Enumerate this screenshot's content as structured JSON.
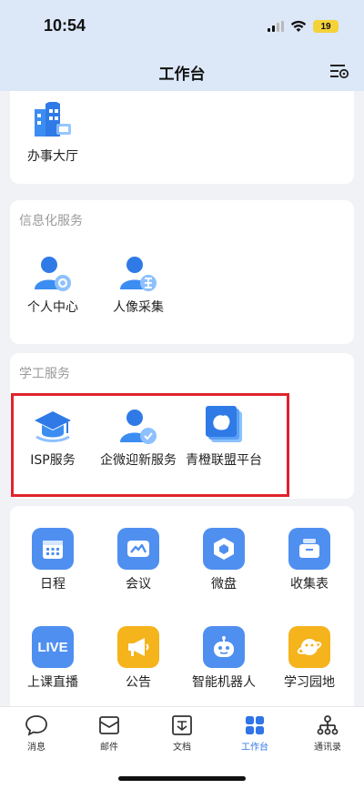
{
  "status_bar": {
    "time": "10:54",
    "battery": "19"
  },
  "header": {
    "title": "工作台"
  },
  "sections": {
    "top": {
      "items": [
        {
          "label": "办事大厅"
        }
      ]
    },
    "info": {
      "title": "信息化服务",
      "items": [
        {
          "label": "个人中心"
        },
        {
          "label": "人像采集"
        }
      ]
    },
    "student": {
      "title": "学工服务",
      "items": [
        {
          "label": "ISP服务"
        },
        {
          "label": "企微迎新服务"
        },
        {
          "label": "青橙联盟平台"
        }
      ]
    },
    "apps": {
      "items": [
        {
          "label": "日程",
          "color": "#4f8ff0"
        },
        {
          "label": "会议",
          "color": "#4f8ff0"
        },
        {
          "label": "微盘",
          "color": "#4f8ff0"
        },
        {
          "label": "收集表",
          "color": "#4f8ff0"
        },
        {
          "label": "上课直播",
          "color": "#4f8ff0"
        },
        {
          "label": "公告",
          "color": "#f5b31c"
        },
        {
          "label": "智能机器人",
          "color": "#4f8ff0"
        },
        {
          "label": "学习园地",
          "color": "#f5b31c"
        }
      ]
    }
  },
  "tabbar": {
    "tabs": [
      {
        "label": "消息"
      },
      {
        "label": "邮件"
      },
      {
        "label": "文档"
      },
      {
        "label": "工作台"
      },
      {
        "label": "通讯录"
      }
    ]
  },
  "colors": {
    "accent": "#2f74e8",
    "highlight_box": "#e0232b"
  }
}
